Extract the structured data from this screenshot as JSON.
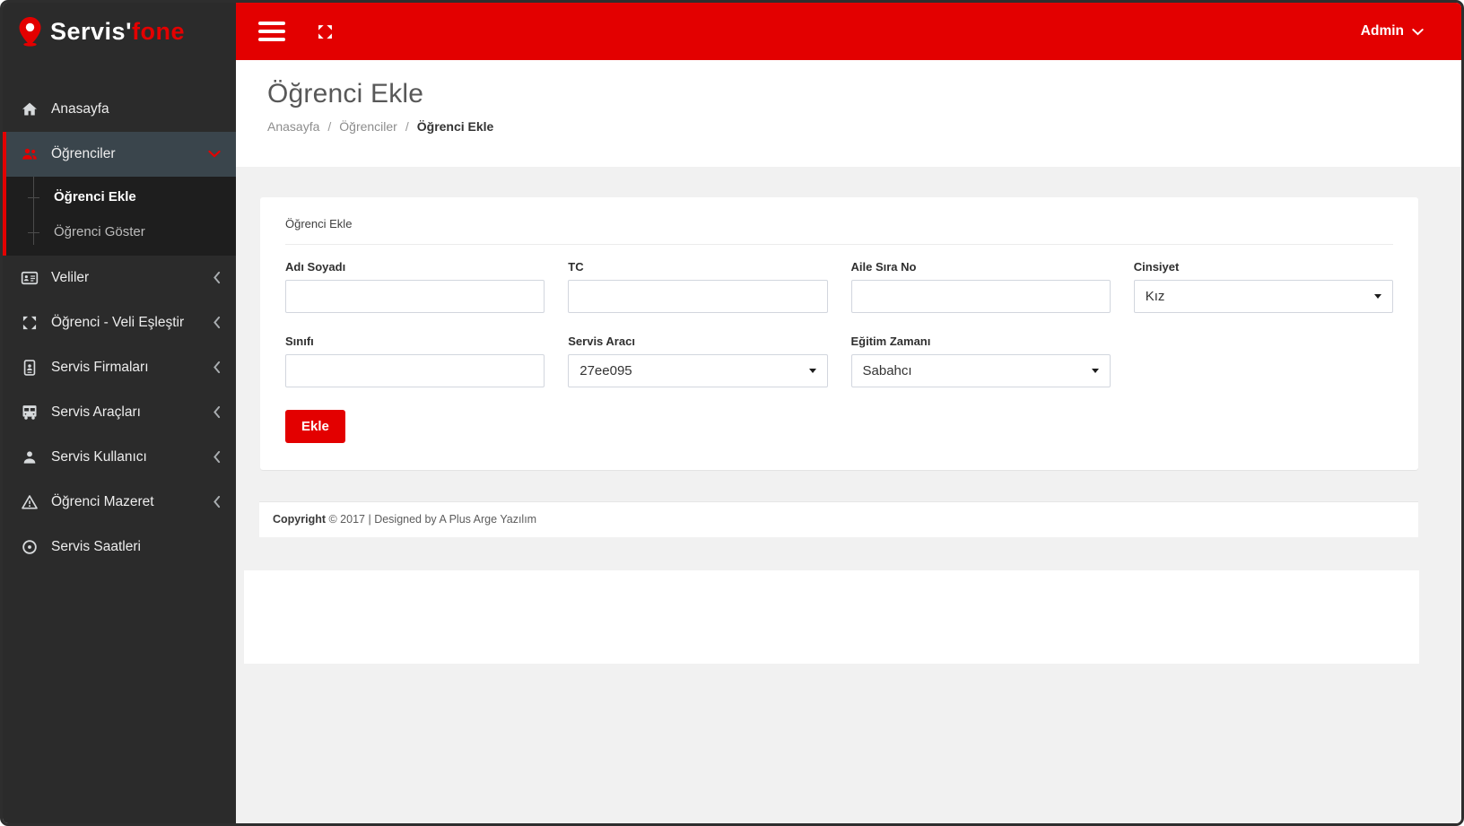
{
  "brand": {
    "name": "Servis",
    "apostrophe": "'",
    "suffix": "fone"
  },
  "topbar": {
    "user": {
      "label": "Admin"
    }
  },
  "sidebar": {
    "items": [
      {
        "label": "Anasayfa",
        "icon": "home-icon"
      },
      {
        "label": "Öğrenciler",
        "icon": "users-icon",
        "children": [
          {
            "label": "Öğrenci Ekle"
          },
          {
            "label": "Öğrenci Göster"
          }
        ]
      },
      {
        "label": "Veliler",
        "icon": "id-card-icon"
      },
      {
        "label": "Öğrenci - Veli Eşleştir",
        "icon": "arrows-icon"
      },
      {
        "label": "Servis Firmaları",
        "icon": "address-card-icon"
      },
      {
        "label": "Servis Araçları",
        "icon": "bus-icon"
      },
      {
        "label": "Servis Kullanıcı",
        "icon": "user-icon"
      },
      {
        "label": "Öğrenci Mazeret",
        "icon": "warning-icon"
      },
      {
        "label": "Servis Saatleri",
        "icon": "clock-icon"
      }
    ]
  },
  "page": {
    "title": "Öğrenci Ekle",
    "breadcrumb": {
      "items": [
        "Anasayfa",
        "Öğrenciler",
        "Öğrenci Ekle"
      ],
      "separator": "/"
    }
  },
  "form": {
    "card_title": "Öğrenci Ekle",
    "rows": [
      {
        "fields": [
          {
            "label": "Adı Soyadı",
            "type": "text",
            "value": ""
          },
          {
            "label": "TC",
            "type": "text",
            "value": ""
          },
          {
            "label": "Aile Sıra No",
            "type": "text",
            "value": ""
          },
          {
            "label": "Cinsiyet",
            "type": "select",
            "value": "Kız"
          }
        ]
      },
      {
        "fields": [
          {
            "label": "Sınıfı",
            "type": "text",
            "value": ""
          },
          {
            "label": "Servis Aracı",
            "type": "select",
            "value": "27ee095"
          },
          {
            "label": "Eğitim Zamanı",
            "type": "select",
            "value": "Sabahcı"
          }
        ]
      }
    ],
    "submit_label": "Ekle"
  },
  "footer": {
    "copyright_bold": "Copyright",
    "copyright_rest": " © 2017 | Designed by A Plus Arge Yazılım"
  },
  "colors": {
    "accent_red": "#e30000",
    "sidebar_bg": "#2b2b2b",
    "active_item_bg": "#3a454c",
    "submenu_bg": "#1e1e1e",
    "content_bg": "#f1f1f1",
    "input_border": "#d2d6de"
  }
}
